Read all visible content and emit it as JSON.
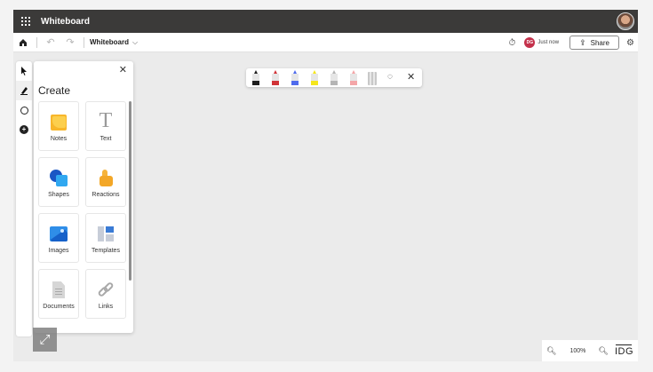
{
  "titlebar": {
    "app_title": "Whiteboard"
  },
  "commandbar": {
    "board_name": "Whiteboard",
    "presence_initials": "DG",
    "sync_status": "Just now",
    "share_label": "Share"
  },
  "panel": {
    "title": "Create",
    "tiles": [
      {
        "label": "Notes",
        "icon": "sticky-note-icon"
      },
      {
        "label": "Text",
        "icon": "text-icon"
      },
      {
        "label": "Shapes",
        "icon": "shapes-icon"
      },
      {
        "label": "Reactions",
        "icon": "thumbs-up-icon"
      },
      {
        "label": "Images",
        "icon": "image-icon"
      },
      {
        "label": "Templates",
        "icon": "templates-icon"
      },
      {
        "label": "Documents",
        "icon": "document-icon"
      },
      {
        "label": "Links",
        "icon": "link-icon"
      }
    ]
  },
  "ink_toolbar": {
    "pens": [
      {
        "name": "black-pen",
        "color": "#1f1f1f"
      },
      {
        "name": "red-pen",
        "color": "#d13438"
      },
      {
        "name": "blue-pen",
        "color": "#4f6bed"
      },
      {
        "name": "yellow-highlighter",
        "color": "#f5e61c"
      },
      {
        "name": "gray-marker",
        "color": "#b5b5b5"
      },
      {
        "name": "pink-marker",
        "color": "#f4a6a8"
      },
      {
        "name": "ruler",
        "color": "#c8c8c8"
      }
    ]
  },
  "zoom": {
    "level": "100%"
  },
  "watermark": "IDG"
}
